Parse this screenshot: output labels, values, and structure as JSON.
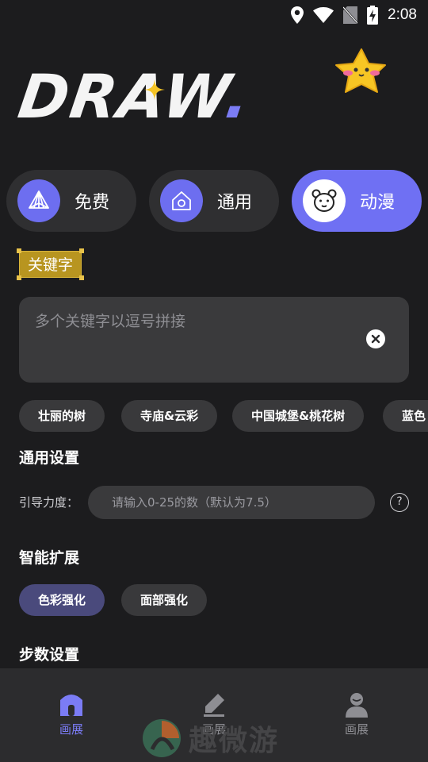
{
  "status_bar": {
    "time": "2:08"
  },
  "logo": {
    "word": "DRAW",
    "dot": "."
  },
  "categories": [
    {
      "label": "免费",
      "icon": "prism-icon",
      "active": false
    },
    {
      "label": "通用",
      "icon": "house-icon",
      "active": false
    },
    {
      "label": "动漫",
      "icon": "bear-icon",
      "active": true
    }
  ],
  "keyword": {
    "tag": "关键字",
    "placeholder": "多个关键字以逗号拼接",
    "value": ""
  },
  "suggestions": [
    "壮丽的树",
    "寺庙&云彩",
    "中国城堡&桃花树",
    "蓝色"
  ],
  "general_settings": {
    "title": "通用设置",
    "guidance_label": "引导力度：",
    "guidance_placeholder": "请输入0-25的数（默认为7.5）",
    "help": "?"
  },
  "smart_expand": {
    "title": "智能扩展",
    "options": [
      {
        "label": "色彩强化",
        "selected": true
      },
      {
        "label": "面部强化",
        "selected": false
      }
    ]
  },
  "steps": {
    "title": "步数设置"
  },
  "tabbar": {
    "items": [
      {
        "label": "画展",
        "icon": "home-icon",
        "active": true
      },
      {
        "label": "画展",
        "icon": "pencil-icon",
        "active": false
      },
      {
        "label": "画展",
        "icon": "user-icon",
        "active": false
      }
    ]
  },
  "watermark": {
    "text": "趣微游"
  },
  "colors": {
    "accent": "#6f70f3",
    "background": "#1c1c1e",
    "card": "#2f2f31",
    "tag_gold": "#b89520"
  }
}
